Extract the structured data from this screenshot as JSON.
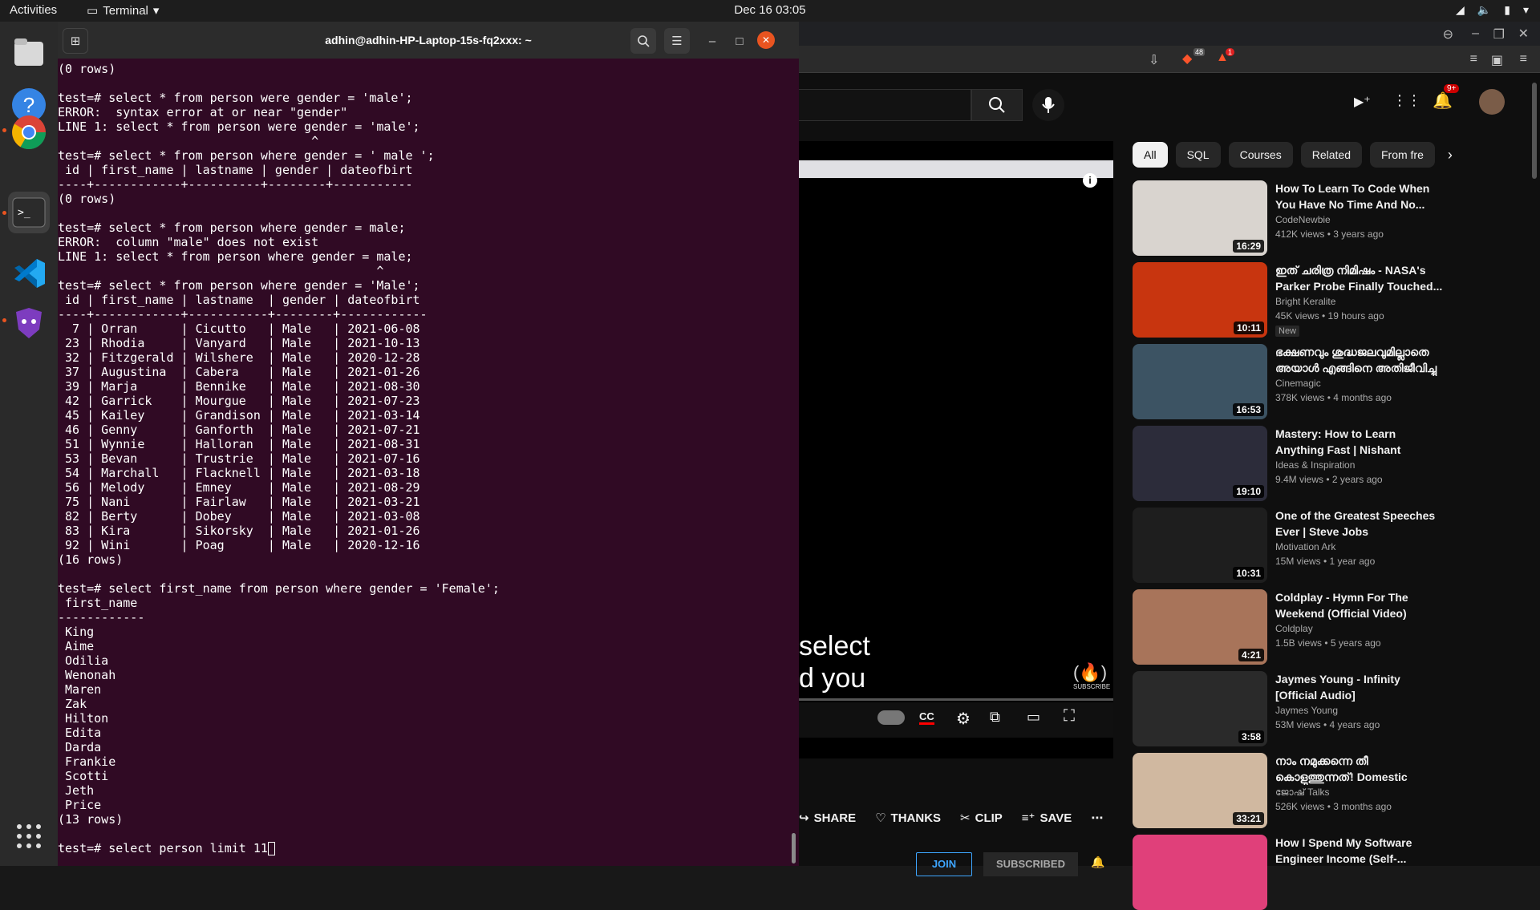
{
  "topbar": {
    "activities": "Activities",
    "app_name": "Terminal",
    "clock": "Dec 16  03:05"
  },
  "dock": {
    "items": [
      "files-icon",
      "help-icon",
      "chrome-icon",
      "terminal-icon",
      "vscode-icon",
      "brave-nightly-icon"
    ],
    "apps_grid": "show-applications-icon"
  },
  "terminal": {
    "title": "adhin@adhin-HP-Laptop-15s-fq2xxx: ~",
    "lines": [
      "(0 rows)",
      "",
      "test=# select * from person were gender = 'male';",
      "ERROR:  syntax error at or near \"gender\"",
      "LINE 1: select * from person were gender = 'male';",
      "                                   ^",
      "test=# select * from person where gender = ' male ';",
      " id | first_name | lastname | gender | dateofbirt",
      "----+------------+----------+--------+-----------",
      "(0 rows)",
      "",
      "test=# select * from person where gender = male;",
      "ERROR:  column \"male\" does not exist",
      "LINE 1: select * from person where gender = male;",
      "                                            ^",
      "test=# select * from person where gender = 'Male';",
      " id | first_name | lastname  | gender | dateofbirt",
      "----+------------+-----------+--------+------------",
      "  7 | Orran      | Cicutto   | Male   | 2021-06-08",
      " 23 | Rhodia     | Vanyard   | Male   | 2021-10-13",
      " 32 | Fitzgerald | Wilshere  | Male   | 2020-12-28",
      " 37 | Augustina  | Cabera    | Male   | 2021-01-26",
      " 39 | Marja      | Bennike   | Male   | 2021-08-30",
      " 42 | Garrick    | Mourgue   | Male   | 2021-07-23",
      " 45 | Kailey     | Grandison | Male   | 2021-03-14",
      " 46 | Genny      | Ganforth  | Male   | 2021-07-21",
      " 51 | Wynnie     | Halloran  | Male   | 2021-08-31",
      " 53 | Bevan      | Trustrie  | Male   | 2021-07-16",
      " 54 | Marchall   | Flacknell | Male   | 2021-03-18",
      " 56 | Melody     | Emney     | Male   | 2021-08-29",
      " 75 | Nani       | Fairlaw   | Male   | 2021-03-21",
      " 82 | Berty      | Dobey     | Male   | 2021-03-08",
      " 83 | Kira       | Sikorsky  | Male   | 2021-01-26",
      " 92 | Wini       | Poag      | Male   | 2020-12-16",
      "(16 rows)",
      "",
      "test=# select first_name from person where gender = 'Female';",
      " first_name",
      "------------",
      " King",
      " Aime",
      " Odilia",
      " Wenonah",
      " Maren",
      " Zak",
      " Hilton",
      " Edita",
      " Darda",
      " Frankie",
      " Scotti",
      " Jeth",
      " Price",
      "(13 rows)",
      ""
    ],
    "prompt_line": "test=# select person limit 11"
  },
  "browser": {
    "chips": [
      "All",
      "SQL",
      "Courses",
      "Related",
      "From fre"
    ],
    "player_caption_line1": "select",
    "player_caption_line2": "d you",
    "player_watermark": "SUBSCRIBE",
    "actions": [
      "SHARE",
      "THANKS",
      "CLIP",
      "SAVE"
    ],
    "join": "JOIN",
    "subscribed": "SUBSCRIBED",
    "notifications_badge": "9+",
    "extension_badge_1": "48",
    "extension_badge_2": "1",
    "recommendations": [
      {
        "title": "How To Learn To Code When You Have No Time And No...",
        "channel": "CodeNewbie",
        "stats": "412K views • 3 years ago",
        "duration": "16:29",
        "badge": "",
        "color": "#d9d4cf"
      },
      {
        "title": "ഇത് ചരിത്ര നിമിഷം - NASA's Parker Probe Finally Touched...",
        "channel": "Bright Keralite",
        "stats": "45K views • 19 hours ago",
        "duration": "10:11",
        "badge": "New",
        "color": "#c8350f"
      },
      {
        "title": "ഭക്ഷണവും ശുദ്ധജലവുമില്ലാതെ അയാൾ എങ്ങിനെ അതിജീവിച്ചു ?",
        "channel": "Cinemagic",
        "stats": "378K views • 4 months ago",
        "duration": "16:53",
        "badge": "",
        "color": "#3c5363"
      },
      {
        "title": "Mastery: How to Learn Anything Fast | Nishant Kasibhatla",
        "channel": "Ideas & Inspiration",
        "stats": "9.4M views • 2 years ago",
        "duration": "19:10",
        "badge": "",
        "color": "#2c2c3a"
      },
      {
        "title": "One of the Greatest Speeches Ever | Steve Jobs",
        "channel": "Motivation Ark",
        "stats": "15M views • 1 year ago",
        "duration": "10:31",
        "badge": "",
        "color": "#1e1e1e"
      },
      {
        "title": "Coldplay - Hymn For The Weekend (Official Video)",
        "channel": "Coldplay",
        "stats": "1.5B views • 5 years ago",
        "duration": "4:21",
        "badge": "",
        "color": "#a8745a"
      },
      {
        "title": "Jaymes Young - Infinity [Official Audio]",
        "channel": "Jaymes Young",
        "stats": "53M views • 4 years ago",
        "duration": "3:58",
        "badge": "",
        "color": "#2a2a2a"
      },
      {
        "title": "നാം നമുക്കന്നെ തീ കൊളുത്തുന്നത്! Domestic Abuse Recovery | Ad...",
        "channel": "ജോഷ് Talks",
        "stats": "526K views • 3 months ago",
        "duration": "33:21",
        "badge": "",
        "color": "#d0b8a0"
      },
      {
        "title": "How I Spend My Software Engineer Income (Self-...",
        "channel": "",
        "stats": "",
        "duration": "",
        "badge": "",
        "color": "#e0407a"
      }
    ]
  }
}
